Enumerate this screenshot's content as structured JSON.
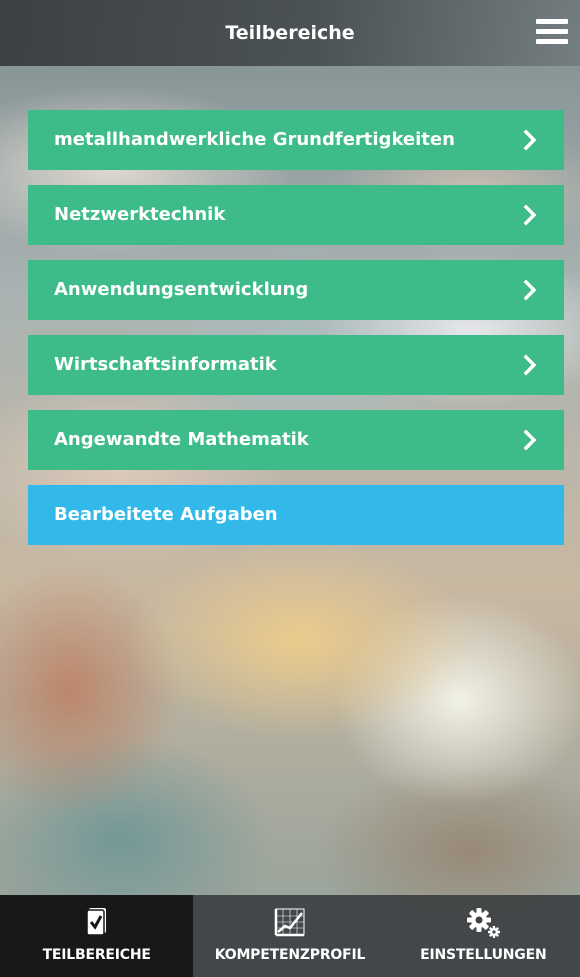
{
  "header": {
    "title": "Teilbereiche",
    "menu_icon": "hamburger-menu-icon"
  },
  "colors": {
    "green_item": "#3dbb89",
    "blue_item": "#32b9ea",
    "topbar": "#3a3e40",
    "bottombar": "#3e4244",
    "active_tab": "#161819"
  },
  "list": {
    "items": [
      {
        "label": "metallhandwerkliche Grundfertigkeiten",
        "icon": "chevron-right-icon"
      },
      {
        "label": "Netzwerktechnik",
        "icon": "chevron-right-icon"
      },
      {
        "label": "Anwendungsentwicklung",
        "icon": "chevron-right-icon"
      },
      {
        "label": "Wirtschaftsinformatik",
        "icon": "chevron-right-icon"
      },
      {
        "label": "Angewandte Mathematik",
        "icon": "chevron-right-icon"
      }
    ],
    "edited": {
      "label": "Bearbeitete Aufgaben"
    }
  },
  "tabbar": {
    "tabs": [
      {
        "label": "TEILBEREICHE",
        "icon": "checklist-icon",
        "active": true
      },
      {
        "label": "KOMPETENZPROFIL",
        "icon": "chart-icon",
        "active": false
      },
      {
        "label": "EINSTELLUNGEN",
        "icon": "gears-icon",
        "active": false
      }
    ]
  }
}
